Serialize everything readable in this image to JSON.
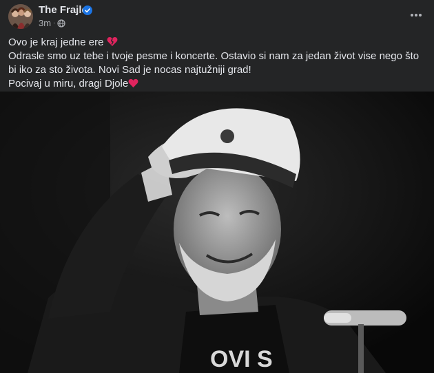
{
  "post": {
    "author": "The Frajle",
    "timestamp": "3m",
    "separator": "·",
    "privacy_icon": "globe-icon",
    "verified_icon": "verified-badge-icon",
    "menu_icon": "more-horizontal-icon",
    "lines": [
      "Ovo je kraj jedne ere",
      "Odrasle smo uz tebe i tvoje pesme i koncerte. Ostavio si nam za jedan život vise nego što bi iko za sto života. Novi Sad je nocas najtužniji grad!",
      "Pocivaj u miru, dragi Djole"
    ],
    "emojis": [
      "broken-heart-icon",
      "red-heart-icon"
    ],
    "photo_caption_text": "OVI S"
  },
  "colors": {
    "background": "#242526",
    "text_primary": "#e4e6eb",
    "text_secondary": "#b0b3b8",
    "verified_blue": "#1b74e4",
    "heart_red": "#e0245e"
  }
}
